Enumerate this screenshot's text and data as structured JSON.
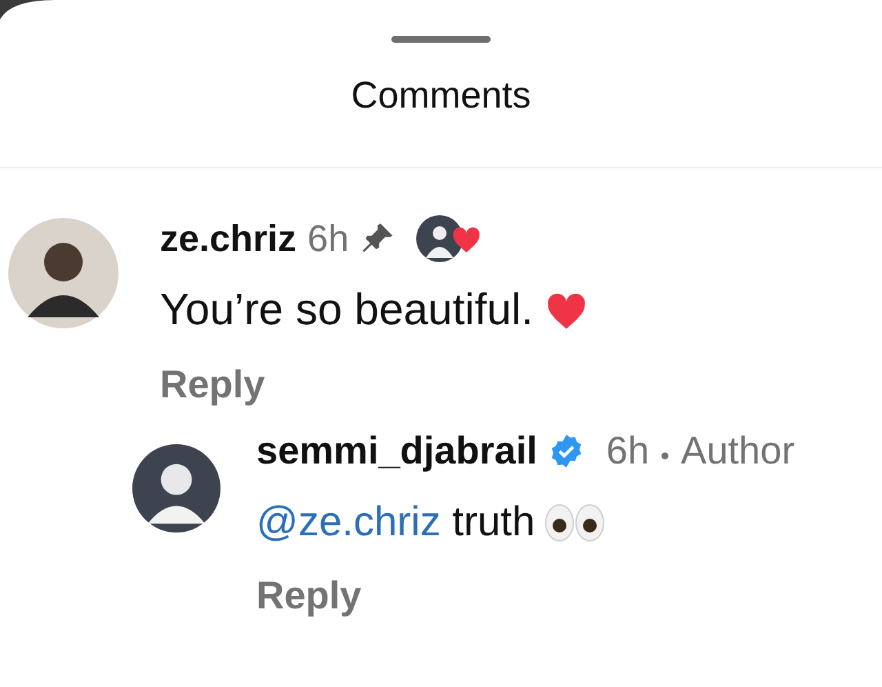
{
  "sheet": {
    "title": "Comments"
  },
  "comments": [
    {
      "username": "ze.chriz",
      "time": "6h",
      "pinned": true,
      "liked_by_author": true,
      "verified": false,
      "text": "You’re so beautiful.",
      "kind": "heart",
      "reply": "Reply",
      "children": [
        {
          "username": "semmi_djabrail",
          "time": "6h",
          "pinned": false,
          "liked_by_author": false,
          "verified": true,
          "author_label": "Author",
          "mention": "@ze.chriz",
          "text": "truth",
          "kind": "eyes",
          "reply": "Reply"
        }
      ]
    }
  ]
}
